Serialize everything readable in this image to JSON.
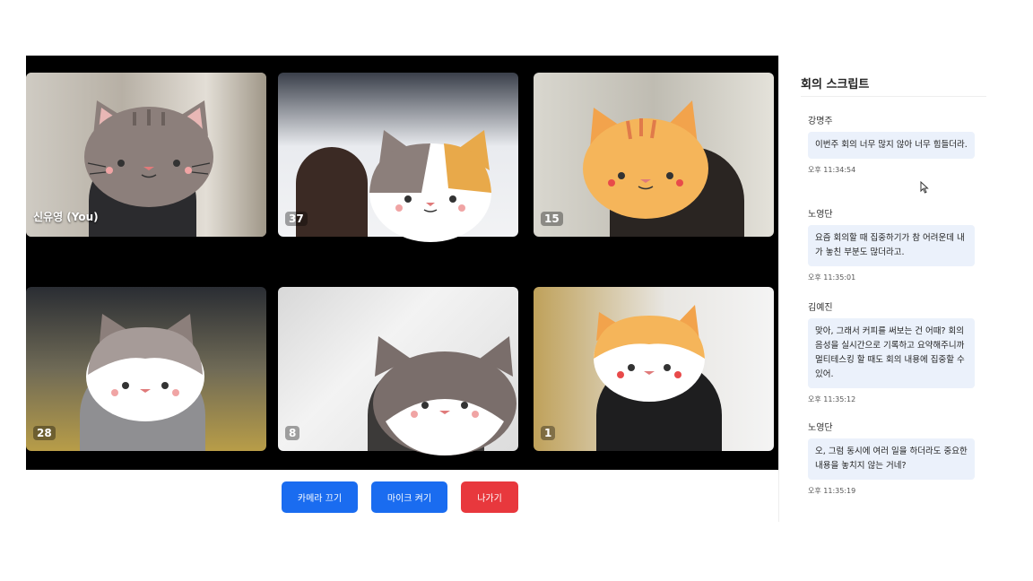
{
  "participants": [
    {
      "label": "신유영 (You)"
    },
    {
      "label": "37"
    },
    {
      "label": "15"
    },
    {
      "label": "28"
    },
    {
      "label": "8"
    },
    {
      "label": "1"
    }
  ],
  "controls": {
    "camera_label": "카메라 끄기",
    "mic_label": "마이크 켜기",
    "leave_label": "나가기"
  },
  "transcript": {
    "title": "회의 스크립트",
    "messages": [
      {
        "speaker": "강명주",
        "text": "이번주 회의 너무 많지 않아 너무 힘들더라.",
        "time": "오후 11:34:54"
      },
      {
        "speaker": "노영단",
        "text": "요즘 회의할 때 집중하기가 참 어려운데 내가 놓친 부분도 많더라고.",
        "time": "오후 11:35:01"
      },
      {
        "speaker": "김예진",
        "text": "맞아, 그래서 커피를 써보는 건 어때? 회의 음성을 실시간으로 기록하고 요약해주니까 멀티테스킹 할 때도 회의 내용에 집중할 수 있어.",
        "time": "오후 11:35:12"
      },
      {
        "speaker": "노영단",
        "text": "오, 그럼 동시에 여러 일을 하더라도 중요한 내용을 놓치지 않는 거네?",
        "time": "오후 11:35:19"
      }
    ]
  },
  "colors": {
    "primary_button": "#1a6cf0",
    "danger_button": "#e8383d",
    "bubble_bg": "#ebf1fb"
  }
}
